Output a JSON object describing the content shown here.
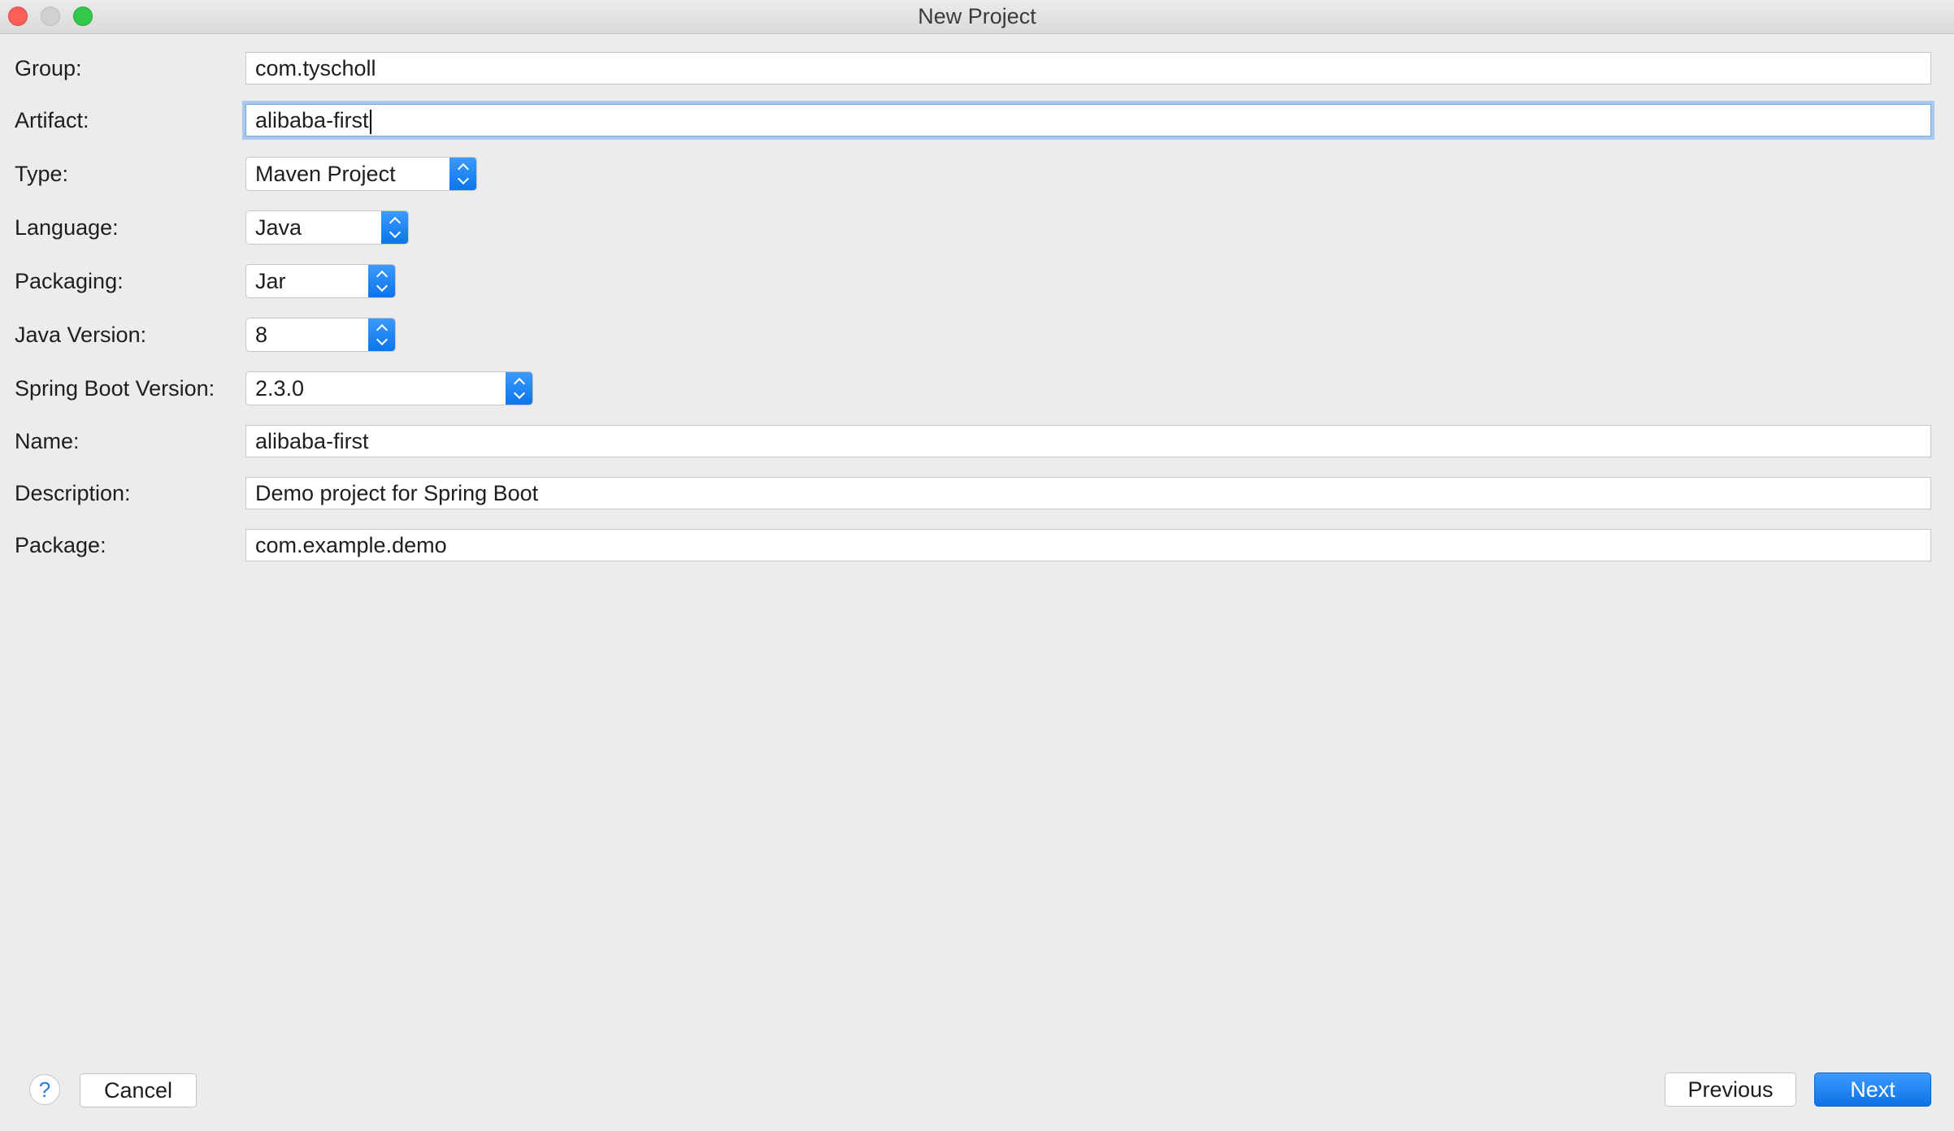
{
  "window": {
    "title": "New Project"
  },
  "form": {
    "group": {
      "label": "Group:",
      "value": "com.tyscholl"
    },
    "artifact": {
      "label": "Artifact:",
      "value": "alibaba-first"
    },
    "type": {
      "label": "Type:",
      "value": "Maven Project"
    },
    "language": {
      "label": "Language:",
      "value": "Java"
    },
    "packaging": {
      "label": "Packaging:",
      "value": "Jar"
    },
    "java_version": {
      "label": "Java Version:",
      "value": "8"
    },
    "spring_boot_version": {
      "label": "Spring Boot Version:",
      "value": "2.3.0"
    },
    "name": {
      "label": "Name:",
      "value": "alibaba-first"
    },
    "description": {
      "label": "Description:",
      "value": "Demo project for Spring Boot"
    },
    "package": {
      "label": "Package:",
      "value": "com.example.demo"
    }
  },
  "footer": {
    "help_icon": "?",
    "cancel_label": "Cancel",
    "previous_label": "Previous",
    "next_label": "Next"
  },
  "colors": {
    "accent": "#0a74e8",
    "focus_ring": "#a8c8ee",
    "background": "#ececec"
  },
  "icons": {
    "close": "close-icon",
    "minimize": "minimize-icon",
    "zoom": "zoom-icon",
    "select_arrows": "updown-chevron-icon",
    "help": "question-mark-icon"
  }
}
